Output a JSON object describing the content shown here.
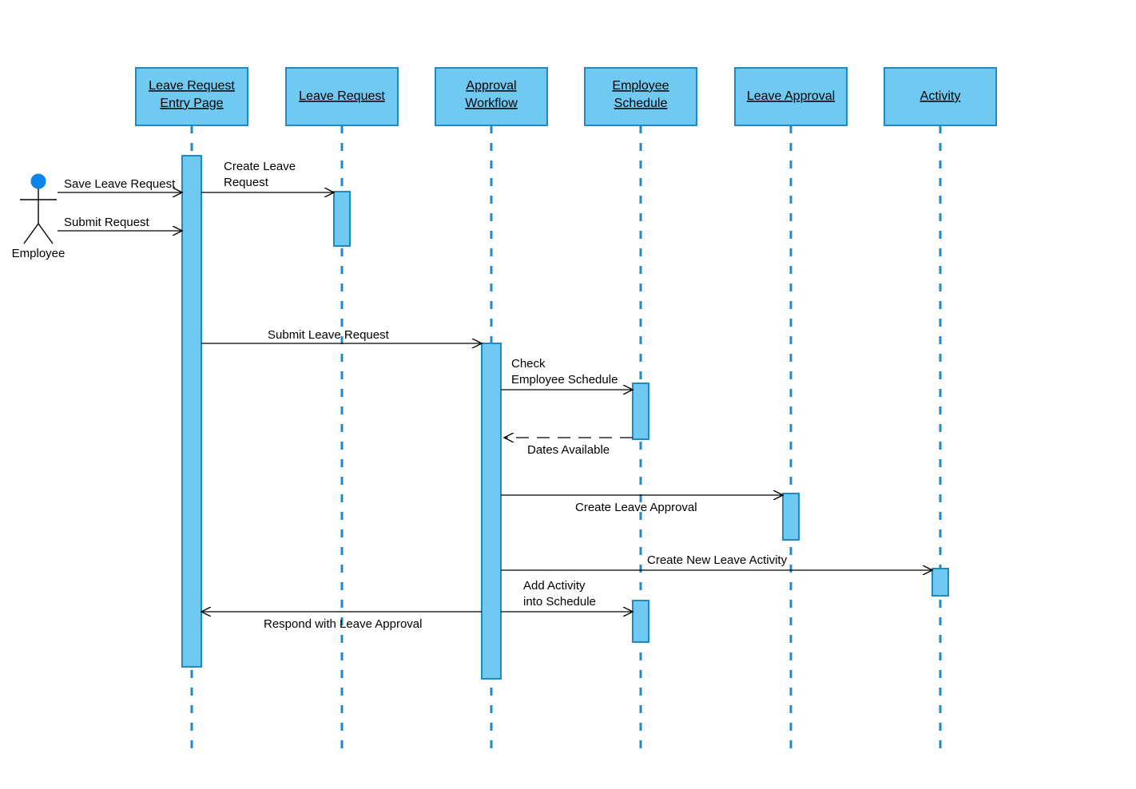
{
  "actor": {
    "label": "Employee"
  },
  "lifelines": {
    "entry": {
      "line1": "Leave Request",
      "line2": "Entry Page"
    },
    "request": {
      "line1": "Leave Request"
    },
    "workflow": {
      "line1": "Approval",
      "line2": "Workflow"
    },
    "schedule": {
      "line1": "Employee",
      "line2": "Schedule"
    },
    "approval": {
      "line1": "Leave Approval"
    },
    "activity": {
      "line1": "Activity"
    }
  },
  "messages": {
    "save_leave_request": "Save Leave Request",
    "submit_request": "Submit  Request",
    "create_leave_request_l1": "Create Leave",
    "create_leave_request_l2": "Request",
    "submit_leave_request": "Submit  Leave Request",
    "check_l1": "Check",
    "check_l2": "Employee Schedule",
    "dates_available": "Dates Available",
    "create_leave_approval": "Create Leave Approval",
    "create_new_leave_activity": "Create New Leave Activity",
    "add_activity_l1": "Add Activity",
    "add_activity_l2": "into Schedule",
    "respond_with_leave_approval": "Respond with Leave Approval"
  }
}
